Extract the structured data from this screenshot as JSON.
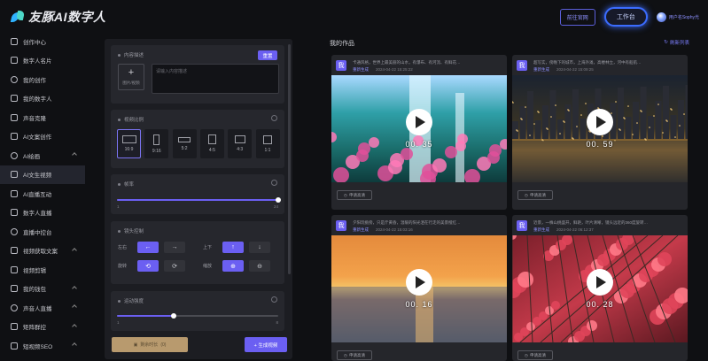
{
  "app": {
    "logo_text": "友豚AI数字人"
  },
  "header": {
    "btn_experience": "前往官网",
    "btn_workbench": "工作台",
    "user_name": "用户名Sophy光"
  },
  "sidebar": {
    "items": [
      {
        "label": "创作中心",
        "icon": "grid-icon",
        "chev": false
      },
      {
        "label": "数字人名片",
        "icon": "id-card-icon",
        "chev": false
      },
      {
        "label": "我的创作",
        "icon": "play-square-icon",
        "chev": false
      },
      {
        "label": "我的数字人",
        "icon": "person-icon",
        "chev": false
      },
      {
        "label": "声音克隆",
        "icon": "soundwave-icon",
        "chev": false
      },
      {
        "label": "AI文案创作",
        "icon": "text-icon",
        "chev": false
      },
      {
        "label": "AI绘画",
        "icon": "palette-icon",
        "chev": true
      },
      {
        "label": "AI文生视频",
        "icon": "video-icon",
        "chev": false,
        "active": true
      },
      {
        "label": "AI直播互动",
        "icon": "chat-icon",
        "chev": false
      },
      {
        "label": "数字人直播",
        "icon": "live-icon",
        "chev": false
      },
      {
        "label": "直播中控台",
        "icon": "console-icon",
        "chev": false
      },
      {
        "label": "视频获取文案",
        "icon": "download-icon",
        "chev": true
      },
      {
        "label": "视频剪辑",
        "icon": "scissors-icon",
        "chev": false
      },
      {
        "label": "我的钱包",
        "icon": "wallet-icon",
        "chev": true
      },
      {
        "label": "声音人直播",
        "icon": "mic-icon",
        "chev": true
      },
      {
        "label": "矩阵群控",
        "icon": "matrix-icon",
        "chev": true
      },
      {
        "label": "短视频SEO",
        "icon": "seo-icon",
        "chev": true
      }
    ]
  },
  "panel": {
    "content_title": "内容描述",
    "content_btn": "重置",
    "upload_label": "图片/视频",
    "textarea_placeholder": "请输入内容描述",
    "ratio_title": "视频比例",
    "ratios": [
      "16:9",
      "9:16",
      "5:2",
      "4:5",
      "4:3",
      "1:1"
    ],
    "ratio_selected": "16:9",
    "duration_title": "帧率",
    "duration_min": "1",
    "duration_max": "24",
    "duration_value_fraction": 1.0,
    "camera_title": "镜头控制",
    "camera_rows": [
      {
        "label_left": "左右",
        "btn1": "←",
        "btn2": "→",
        "label_right": "上下",
        "btn3": "↑",
        "btn4": "↓"
      },
      {
        "label_left": "旋转",
        "btn1": "⟲",
        "btn2": "⟳",
        "label_right": "缩放",
        "btn3": "⊕",
        "btn4": "⊖"
      }
    ],
    "motion_title": "运动强度",
    "motion_min": "1",
    "motion_max": "8",
    "motion_value_fraction": 0.35,
    "remain_label": "剩余时长",
    "remain_value": "(0)",
    "generate_label": "+ 生成视频"
  },
  "works": {
    "title": "我的作品",
    "refresh": "刷新列表",
    "items": [
      {
        "badge": "我",
        "desc": "卡通风格，世界上最美丽的山水，有瀑布、有河流、有鲜花…",
        "status": "重新生成",
        "time": "2024-04-22 15:25:22",
        "duration": "00. 35",
        "hd": "申请高清",
        "scene": "waterfall"
      },
      {
        "badge": "我",
        "desc": "超写实，傍晚下的城市，上海外滩，高楼林立，河中有船航…",
        "status": "重新生成",
        "time": "2024-04-22 15:09:25",
        "duration": "00. 59",
        "hd": "申请高清",
        "scene": "city"
      },
      {
        "badge": "我",
        "desc": "夕阳玩挑傍，只是斤黄昏，温暖的阳光洒在行走的美景橙红…",
        "status": "重新生成",
        "time": "2024-04-22 15:03:16",
        "duration": "00. 16",
        "hd": "申请高清",
        "scene": "sunset"
      },
      {
        "badge": "我",
        "desc": "近景，一株山桃盛开，鲜艳，叶片清晰，镜头远近的360度旋转…",
        "status": "重新生成",
        "time": "2024-04-22 06:12:37",
        "duration": "00. 28",
        "hd": "申请高清",
        "scene": "flowers"
      }
    ]
  }
}
